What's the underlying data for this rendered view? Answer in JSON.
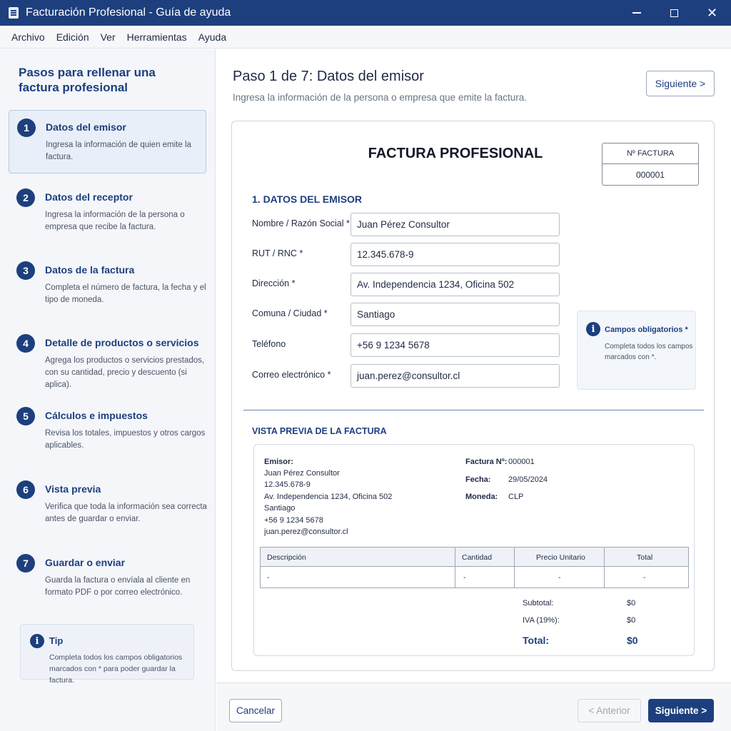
{
  "window": {
    "title": "Facturación Profesional - Guía de ayuda",
    "minimize": "—",
    "maximize": "☐",
    "close": "✕"
  },
  "menu": [
    "Archivo",
    "Edición",
    "Ver",
    "Herramientas",
    "Ayuda"
  ],
  "sidebar": {
    "title": "Pasos para rellenar una factura profesional",
    "steps": [
      {
        "number": "1",
        "title": "Datos del emisor",
        "description": "Ingresa la información de quien emite la factura."
      },
      {
        "number": "2",
        "title": "Datos del receptor",
        "description": "Ingresa la información de la persona o empresa que recibe la factura."
      },
      {
        "number": "3",
        "title": "Datos de la factura",
        "description": "Completa el número de factura, la fecha y el tipo de moneda."
      },
      {
        "number": "4",
        "title": "Detalle de productos o servicios",
        "description": "Agrega los productos o servicios prestados, con su cantidad, precio y descuento (si aplica)."
      },
      {
        "number": "5",
        "title": "Cálculos e impuestos",
        "description": "Revisa los totales, impuestos y otros cargos aplicables."
      },
      {
        "number": "6",
        "title": "Vista previa",
        "description": "Verifica que toda la información sea correcta antes de guardar o enviar."
      },
      {
        "number": "7",
        "title": "Guardar o enviar",
        "description": "Guarda la factura o envíala al cliente en formato PDF o por correo electrónico."
      }
    ],
    "active_step": 1,
    "tip": {
      "icon": "i",
      "title": "Tip",
      "text": "Completa todos los campos obligatorios marcados con * para poder guardar la factura."
    }
  },
  "main": {
    "title": "Paso 1 de 7: Datos del emisor",
    "subtitle": "Ingresa la información de la persona o empresa que emite la factura.",
    "next_top": "Siguiente >"
  },
  "invoice": {
    "title": "FACTURA PROFESIONAL",
    "number_label": "Nº FACTURA",
    "number_value": "000001",
    "section_title": "1. DATOS DEL EMISOR",
    "fields": [
      {
        "label": "Nombre / Razón Social *",
        "value": "Juan Pérez Consultor"
      },
      {
        "label": "RUT / RNC *",
        "value": "12.345.678-9"
      },
      {
        "label": "Dirección *",
        "value": "Av. Independencia 1234, Oficina 502"
      },
      {
        "label": "Comuna / Ciudad *",
        "value": "Santiago"
      },
      {
        "label": "Teléfono",
        "value": "+56 9 1234 5678"
      },
      {
        "label": "Correo electrónico *",
        "value": "juan.perez@consultor.cl"
      }
    ],
    "required_note": {
      "icon": "i",
      "title": "Campos obligatorios *",
      "text": "Completa todos los campos marcados con *."
    }
  },
  "preview": {
    "title": "VISTA PREVIA DE LA FACTURA",
    "emisor_label": "Emisor:",
    "emisor_lines": [
      "Juan Pérez Consultor",
      "12.345.678-9",
      "Av. Independencia 1234, Oficina 502",
      "Santiago",
      "+56 9 1234 5678",
      "juan.perez@consultor.cl"
    ],
    "meta": [
      {
        "label": "Factura Nº:",
        "value": "000001"
      },
      {
        "label": "Fecha:",
        "value": "29/05/2024"
      },
      {
        "label": "Moneda:",
        "value": "CLP"
      }
    ],
    "table_headers": [
      "Descripción",
      "Cantidad",
      "Precio Unitario",
      "Total"
    ],
    "table_row": [
      "-",
      "-",
      "-",
      "-"
    ],
    "totals": [
      {
        "label": "Subtotal:",
        "value": "$0"
      },
      {
        "label": "IVA (19%):",
        "value": "$0"
      },
      {
        "label": "Total:",
        "value": "$0"
      }
    ]
  },
  "footer": {
    "cancel": "Cancelar",
    "previous": "< Anterior",
    "next": "Siguiente >"
  }
}
